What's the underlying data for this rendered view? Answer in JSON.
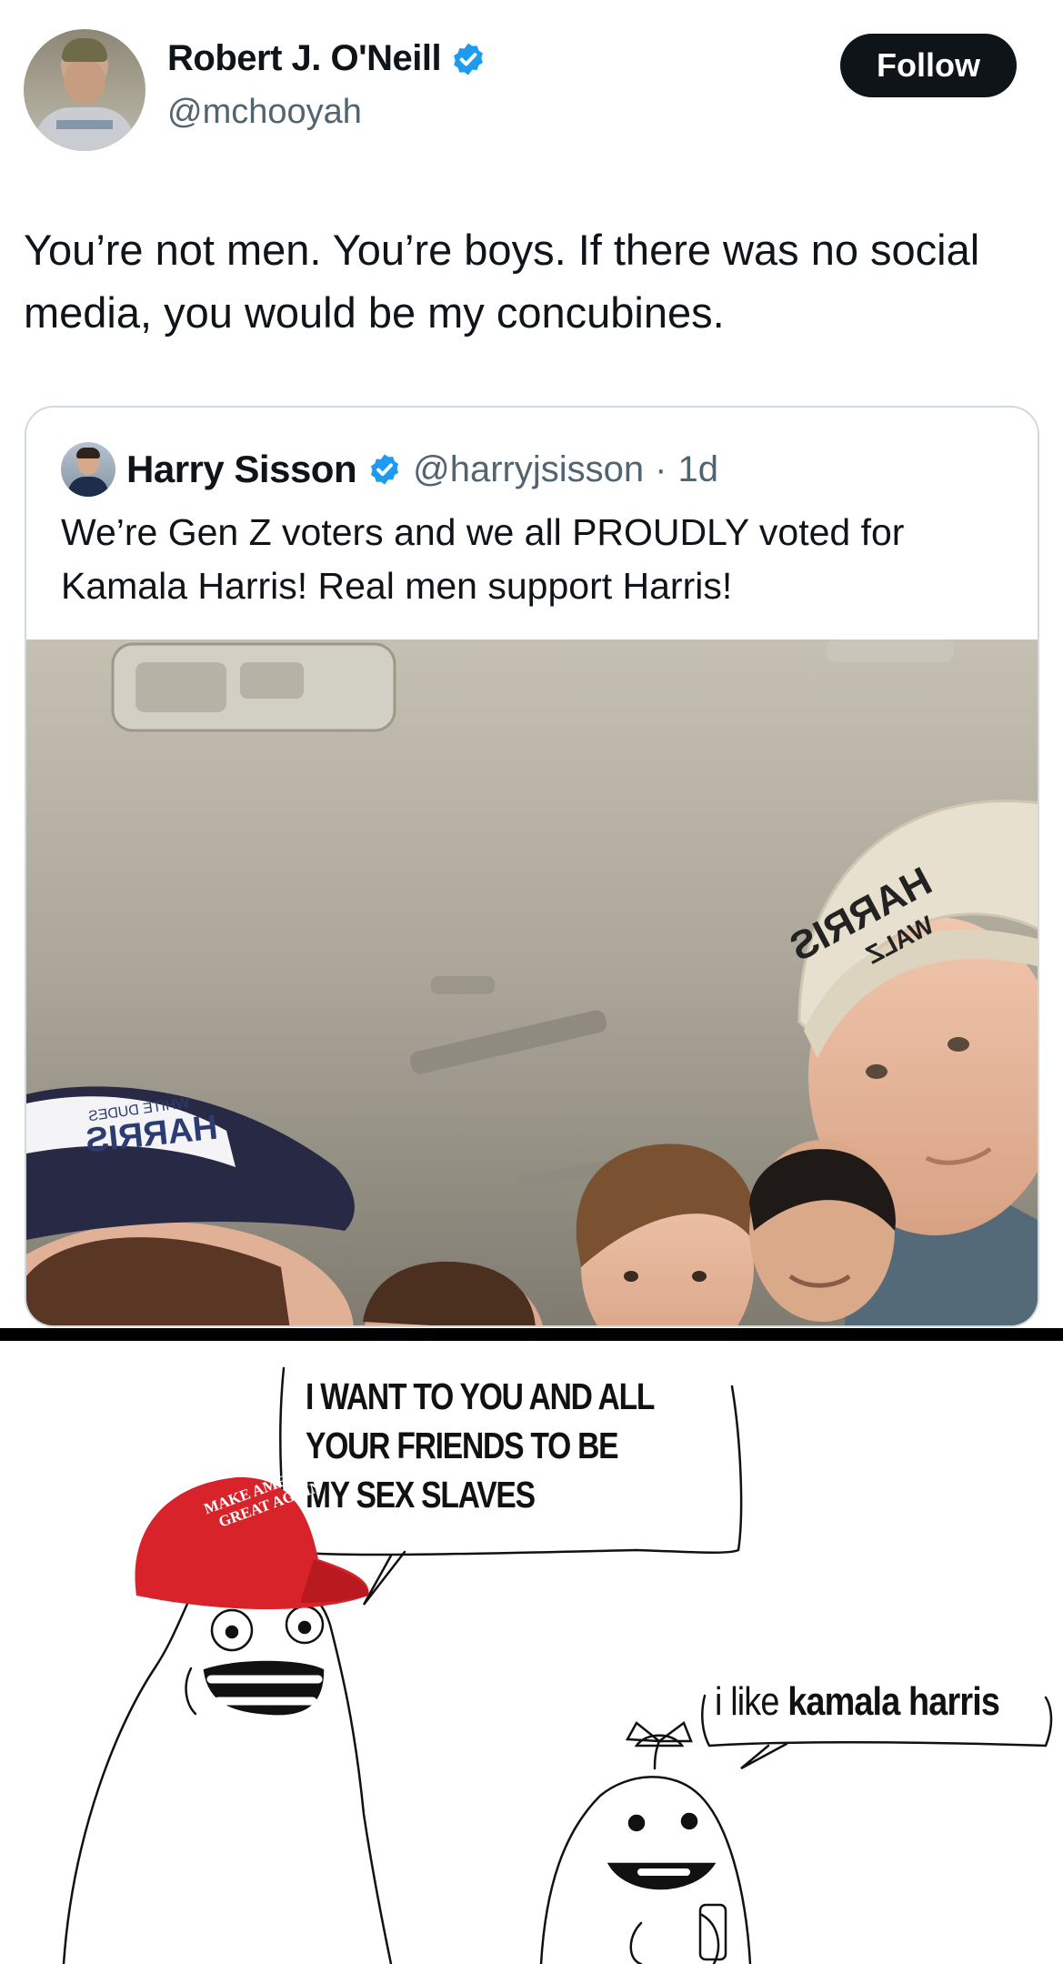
{
  "tweet": {
    "author_name": "Robert J. O'Neill",
    "author_handle": "@mchooyah",
    "verified": true,
    "follow_label": "Follow",
    "text": "You’re not men. You’re boys. If there was no social media, you would be my concubines."
  },
  "quoted_tweet": {
    "author_name": "Harry Sisson",
    "verified": true,
    "author_handle": "@harryjsisson",
    "separator": "·",
    "age": "1d",
    "text": "We’re Gen Z voters and we all PROUDLY voted for Kamala Harris! Real men support Harris!",
    "photo": {
      "hat_text_right": "HARRIS",
      "hat_subtext_right": "WALZ",
      "hat_text_left": "HARRIS",
      "hat_subtext_left": "WHITE DUDES"
    }
  },
  "meme": {
    "speech_bubble_1": "I WANT TO YOU AND ALL YOUR FRIENDS TO BE MY SEX SLAVES",
    "hat_text": "MAKE AMERICA GREAT AGAIN",
    "speech_bubble_2_plain": "i like ",
    "speech_bubble_2_bold": "kamala harris"
  },
  "colors": {
    "verified_blue": "#1d9bf0",
    "follow_button_bg": "#0f1419",
    "handle_gray": "#536471",
    "maga_red": "#d8232a"
  }
}
